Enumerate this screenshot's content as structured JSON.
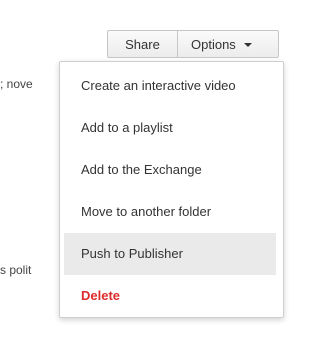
{
  "background": {
    "fragment_1": "; nove",
    "fragment_2": "s polit"
  },
  "toolbar": {
    "share_label": "Share",
    "options_label": "Options",
    "options_icon": "caret-down-icon"
  },
  "menu": {
    "items": [
      {
        "label": "Create an interactive video"
      },
      {
        "label": "Add to a playlist"
      },
      {
        "label": "Add to the Exchange"
      },
      {
        "label": "Move to another folder"
      },
      {
        "label": "Push to Publisher",
        "highlighted": true
      },
      {
        "label": "Delete",
        "danger": true
      }
    ]
  },
  "colors": {
    "danger": "#dd2c2c",
    "highlight": "#eaeaea",
    "border": "#cfcfcf"
  }
}
